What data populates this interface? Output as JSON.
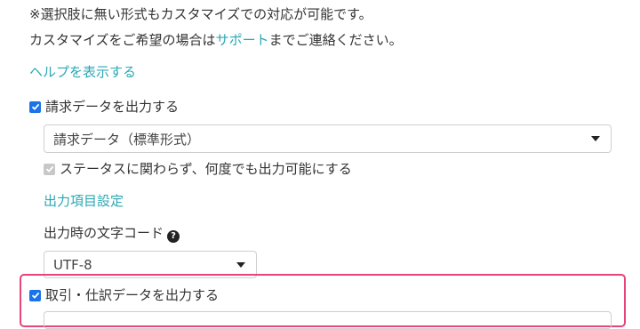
{
  "notes": {
    "line1": "※選択肢に無い形式もカスタマイズでの対応が可能です。",
    "line2_prefix": "カスタマイズをご希望の場合は",
    "line2_link": "サポート",
    "line2_suffix": "までご連絡ください。"
  },
  "help_link": "ヘルプを表示する",
  "billing": {
    "checkbox_label": "請求データを出力する",
    "checked": true,
    "format_select": "請求データ（標準形式）",
    "status_checkbox_label": "ステータスに関わらず、何度でも出力可能にする",
    "status_checked": true,
    "item_settings_link": "出力項目設定",
    "encoding_label": "出力時の文字コード",
    "encoding_help_icon": "question-circle-icon",
    "encoding_value": "UTF-8"
  },
  "journal": {
    "checkbox_label": "取引・仕訳データを出力する",
    "checked": true
  },
  "colors": {
    "link": "#2aa8b5",
    "checkbox": "#1a73e8",
    "highlight": "#e6457a"
  }
}
